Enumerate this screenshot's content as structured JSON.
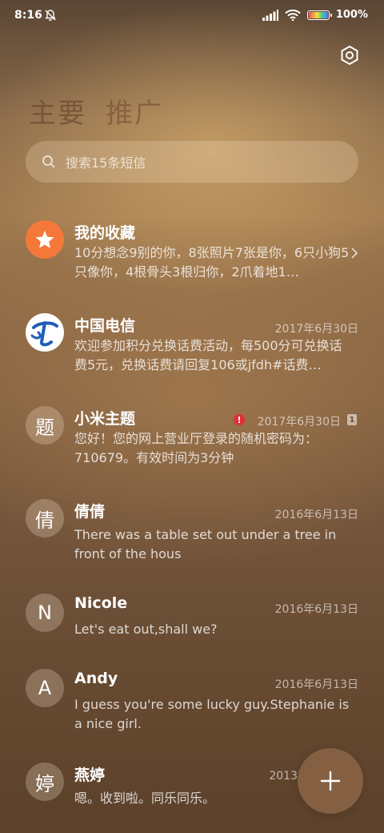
{
  "status_bar": {
    "time": "8:16",
    "battery_pct": "100%",
    "icons": [
      "bell-off-icon",
      "signal-icon",
      "wifi-icon",
      "battery-icon"
    ]
  },
  "header": {
    "tabs": [
      {
        "label": "主要",
        "active": true
      },
      {
        "label": "推广",
        "active": false
      }
    ],
    "settings_icon": "gear-hexagon-icon"
  },
  "search": {
    "placeholder": "搜索15条短信",
    "icon": "search-icon"
  },
  "conversations": [
    {
      "avatar_text": "★",
      "avatar_kind": "star",
      "avatar_color": "#f4783a",
      "name": "我的收藏",
      "date": "",
      "preview": "10分想念9别的你，8张照片7张是你，6只小狗5只像你，4根骨头3根归你，2爪着地1…",
      "chevron": true
    },
    {
      "avatar_text": "",
      "avatar_kind": "china-telecom-logo",
      "name": "中国电信",
      "date": "2017年6月30日",
      "preview": "欢迎参加积分兑换话费活动，每500分可兑换话费5元，兑换话费请回复106或jfdh#话费…"
    },
    {
      "avatar_text": "题",
      "name": "小米主题",
      "date": "2017年6月30日",
      "error_badge": "!",
      "sim_badge": "1",
      "preview": "您好！您的网上营业厅登录的随机密码为：710679。有效时间为3分钟"
    },
    {
      "avatar_text": "倩",
      "name": "倩倩",
      "date": "2016年6月13日",
      "preview": "There was a table set out under a tree in front of the hous"
    },
    {
      "avatar_text": "N",
      "name": "Nicole",
      "date": "2016年6月13日",
      "preview": "Let's eat out,shall we?"
    },
    {
      "avatar_text": "A",
      "name": "Andy",
      "date": "2016年6月13日",
      "preview": "I guess you're some lucky guy.Stephanie is a nice girl."
    },
    {
      "avatar_text": "婷",
      "name": "燕婷",
      "date": "2013",
      "preview": "嗯。收到啦。同乐同乐。"
    }
  ],
  "fab": {
    "icon": "plus-icon"
  }
}
